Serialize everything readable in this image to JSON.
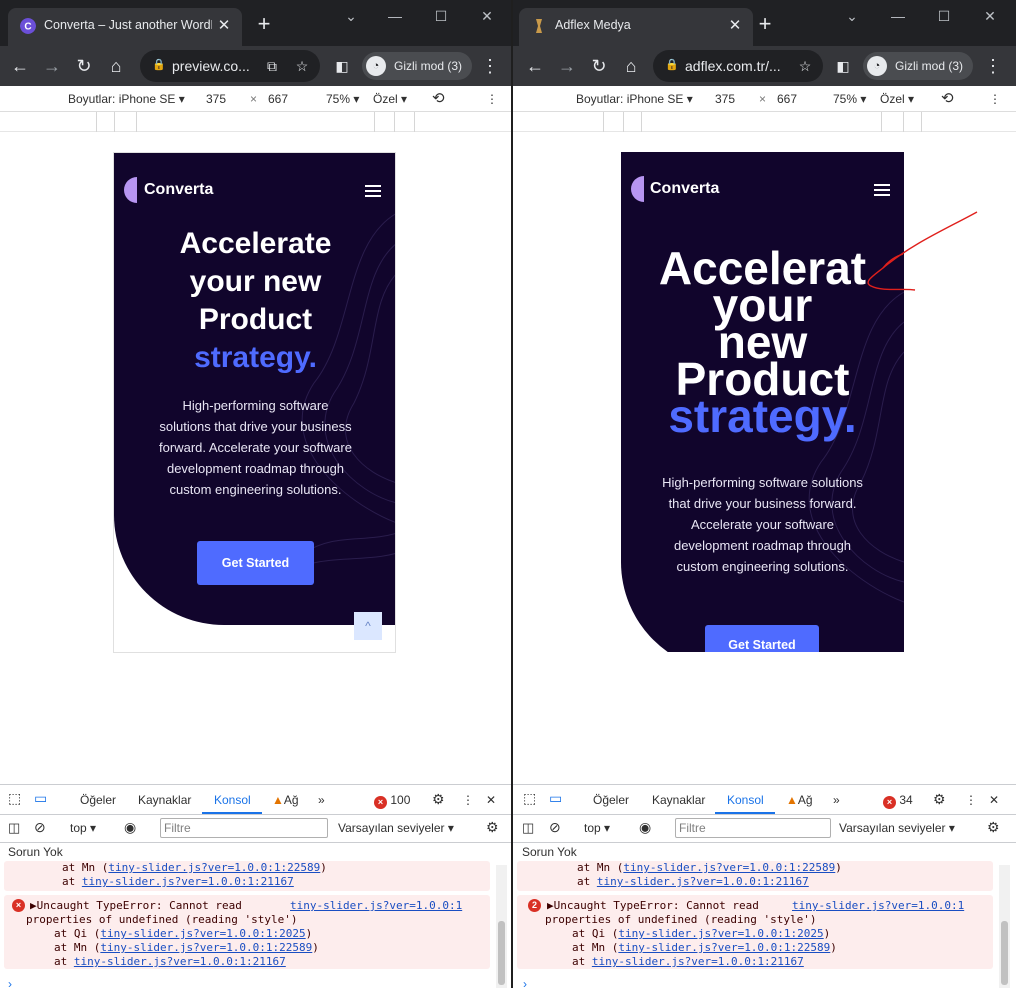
{
  "left": {
    "tab_title": "Converta – Just another WordPress site",
    "url": "preview.co...",
    "incognito_label": "Gizli mod (3)",
    "device": {
      "label": "Boyutlar: iPhone SE",
      "width": "375",
      "x": "×",
      "height": "667",
      "zoom": "75%",
      "throttle": "Özel"
    },
    "page": {
      "brand": "Converta",
      "headline_lines": [
        "Accelerate",
        "your new",
        "Product"
      ],
      "headline_accent": "strategy.",
      "paragraph_lines": [
        "High-performing software",
        "solutions that drive your business",
        "forward. Accelerate your software",
        "development roadmap through",
        "custom engineering solutions."
      ],
      "cta": "Get Started",
      "scroll_top_icon": "^"
    },
    "devtools": {
      "tabs": [
        "Öğeler",
        "Kaynaklar",
        "Konsol",
        "Ağ"
      ],
      "error_count": "100",
      "context": "top",
      "filter_placeholder": "Filtre",
      "levels": "Varsayılan seviyeler",
      "issues": "Sorun Yok",
      "console": {
        "prev_lines": [
          {
            "prefix": "at Mn (",
            "link": "tiny-slider.js?ver=1.0.0:1:22589",
            "suffix": ")"
          },
          {
            "prefix": "at ",
            "link": "tiny-slider.js?ver=1.0.0:1:21167",
            "suffix": ""
          }
        ],
        "error_title": "▶Uncaught TypeError: Cannot read",
        "error_source": "tiny-slider.js?ver=1.0.0:1",
        "error_cont": "properties of undefined (reading 'style')",
        "stack": [
          {
            "prefix": "at Qi (",
            "link": "tiny-slider.js?ver=1.0.0:1:2025",
            "suffix": ")"
          },
          {
            "prefix": "at Mn (",
            "link": "tiny-slider.js?ver=1.0.0:1:22589",
            "suffix": ")"
          },
          {
            "prefix": "at ",
            "link": "tiny-slider.js?ver=1.0.0:1:21167",
            "suffix": ""
          }
        ],
        "error_badge": "×"
      },
      "prompt": "›"
    }
  },
  "right": {
    "tab_title": "Adflex Medya",
    "url": "adflex.com.tr/...",
    "incognito_label": "Gizli mod (3)",
    "device": {
      "label": "Boyutlar: iPhone SE",
      "width": "375",
      "x": "×",
      "height": "667",
      "zoom": "75%",
      "throttle": "Özel"
    },
    "page": {
      "brand": "Converta",
      "headline_lines": [
        "Accelerat",
        "your",
        "new",
        "Product"
      ],
      "headline_accent": "strategy.",
      "paragraph_lines": [
        "High-performing software solutions",
        "that drive your business forward.",
        "Accelerate your software",
        "development roadmap through",
        "custom engineering solutions."
      ],
      "cta": "Get Started"
    },
    "devtools": {
      "tabs": [
        "Öğeler",
        "Kaynaklar",
        "Konsol",
        "Ağ"
      ],
      "error_count": "34",
      "context": "top",
      "filter_placeholder": "Filtre",
      "levels": "Varsayılan seviyeler",
      "issues": "Sorun Yok",
      "console": {
        "prev_lines": [
          {
            "prefix": "at Mn (",
            "link": "tiny-slider.js?ver=1.0.0:1:22589",
            "suffix": ")"
          },
          {
            "prefix": "at ",
            "link": "tiny-slider.js?ver=1.0.0:1:21167",
            "suffix": ""
          }
        ],
        "error_title": "▶Uncaught TypeError: Cannot read",
        "error_source": "tiny-slider.js?ver=1.0.0:1",
        "error_cont": "properties of undefined (reading 'style')",
        "stack": [
          {
            "prefix": "at Qi (",
            "link": "tiny-slider.js?ver=1.0.0:1:2025",
            "suffix": ")"
          },
          {
            "prefix": "at Mn (",
            "link": "tiny-slider.js?ver=1.0.0:1:22589",
            "suffix": ")"
          },
          {
            "prefix": "at ",
            "link": "tiny-slider.js?ver=1.0.0:1:21167",
            "suffix": ""
          }
        ],
        "error_badge": "2"
      },
      "prompt": "›"
    }
  },
  "colors": {
    "hero_bg": "#11052c",
    "accent": "#4f6bff",
    "annotation": "#e0201c"
  }
}
